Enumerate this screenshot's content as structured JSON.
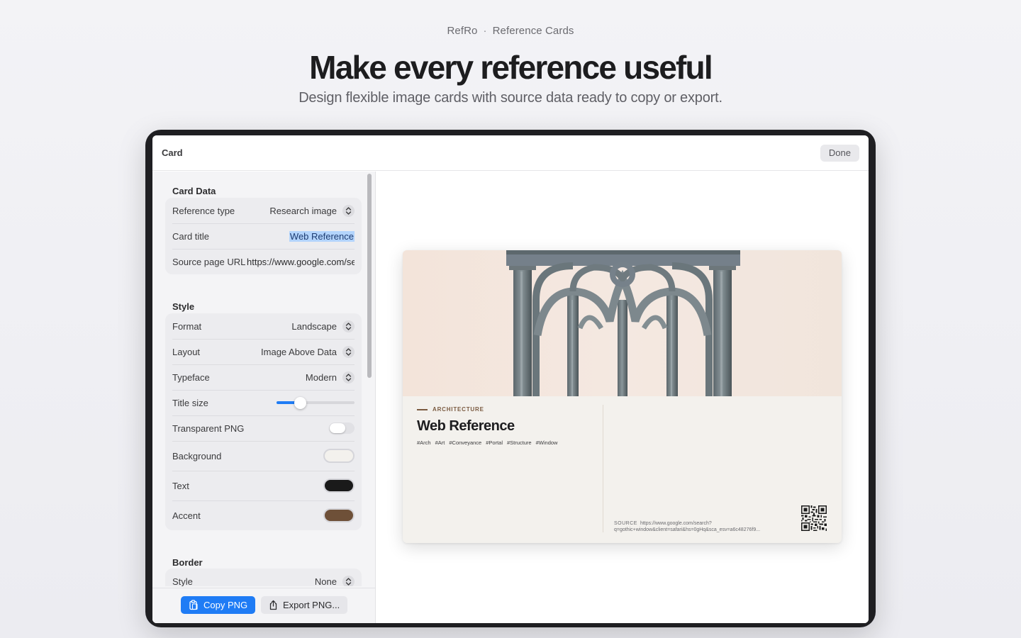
{
  "hero": {
    "app_name": "RefRo",
    "separator": "·",
    "section": "Reference Cards",
    "title": "Make every reference useful",
    "subtitle": "Design flexible image cards with source data ready to copy or export."
  },
  "window": {
    "title": "Card",
    "done_label": "Done"
  },
  "card_data_section": {
    "header": "Card Data",
    "reference_type": {
      "label": "Reference type",
      "value": "Research image"
    },
    "card_title": {
      "label": "Card title",
      "value": "Web Reference"
    },
    "source_url": {
      "label": "Source page URL",
      "value": "https://www.google.com/search?q=gothic+window"
    }
  },
  "style_section": {
    "header": "Style",
    "format": {
      "label": "Format",
      "value": "Landscape"
    },
    "layout": {
      "label": "Layout",
      "value": "Image Above Data"
    },
    "typeface": {
      "label": "Typeface",
      "value": "Modern"
    },
    "title_size": {
      "label": "Title size",
      "level": 0.3
    },
    "transparent_png": {
      "label": "Transparent PNG",
      "on": false
    },
    "background": {
      "label": "Background",
      "color": "#f3f1ed"
    },
    "text": {
      "label": "Text",
      "color": "#1a1a1a"
    },
    "accent": {
      "label": "Accent",
      "color": "#6e5038"
    }
  },
  "border_section": {
    "header": "Border",
    "style": {
      "label": "Style",
      "value": "None"
    }
  },
  "actions": {
    "copy_png": "Copy PNG",
    "export_png": "Export PNG..."
  },
  "card_preview": {
    "category": "ARCHITECTURE",
    "title": "Web Reference",
    "tags": [
      "#Arch",
      "#Art",
      "#Conveyance",
      "#Portal",
      "#Structure",
      "#Window"
    ],
    "source_label": "SOURCE",
    "source_url": "https://www.google.com/search?q=gothic+window&client=safari&hs=0gHq&sca_esv=a6c48276f9..."
  },
  "colors": {
    "accent_blue": "#1f7cf5",
    "selection": "#b3d4fc"
  }
}
